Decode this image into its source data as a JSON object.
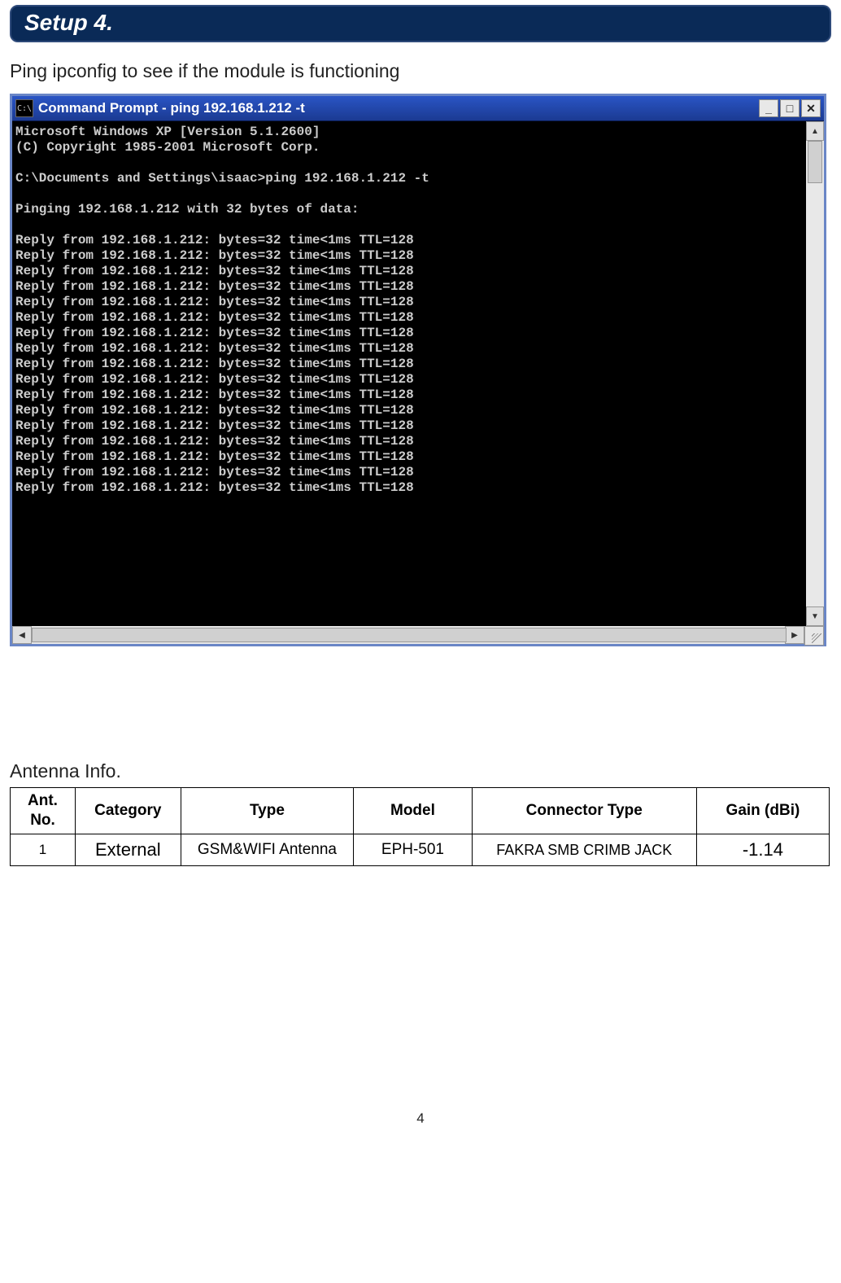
{
  "section_banner": "Setup 4.",
  "intro_text": "Ping ipconfig to see if the module is functioning",
  "cmd": {
    "icon_label": "C:\\",
    "title": "Command Prompt - ping 192.168.1.212 -t",
    "min_glyph": "_",
    "max_glyph": "□",
    "close_glyph": "✕",
    "scroll_up": "▲",
    "scroll_down": "▼",
    "scroll_left": "◀",
    "scroll_right": "▶",
    "lines": [
      "Microsoft Windows XP [Version 5.1.2600]",
      "(C) Copyright 1985-2001 Microsoft Corp.",
      "",
      "C:\\Documents and Settings\\isaac>ping 192.168.1.212 -t",
      "",
      "Pinging 192.168.1.212 with 32 bytes of data:",
      "",
      "Reply from 192.168.1.212: bytes=32 time<1ms TTL=128",
      "Reply from 192.168.1.212: bytes=32 time<1ms TTL=128",
      "Reply from 192.168.1.212: bytes=32 time<1ms TTL=128",
      "Reply from 192.168.1.212: bytes=32 time<1ms TTL=128",
      "Reply from 192.168.1.212: bytes=32 time<1ms TTL=128",
      "Reply from 192.168.1.212: bytes=32 time<1ms TTL=128",
      "Reply from 192.168.1.212: bytes=32 time<1ms TTL=128",
      "Reply from 192.168.1.212: bytes=32 time<1ms TTL=128",
      "Reply from 192.168.1.212: bytes=32 time<1ms TTL=128",
      "Reply from 192.168.1.212: bytes=32 time<1ms TTL=128",
      "Reply from 192.168.1.212: bytes=32 time<1ms TTL=128",
      "Reply from 192.168.1.212: bytes=32 time<1ms TTL=128",
      "Reply from 192.168.1.212: bytes=32 time<1ms TTL=128",
      "Reply from 192.168.1.212: bytes=32 time<1ms TTL=128",
      "Reply from 192.168.1.212: bytes=32 time<1ms TTL=128",
      "Reply from 192.168.1.212: bytes=32 time<1ms TTL=128",
      "Reply from 192.168.1.212: bytes=32 time<1ms TTL=128"
    ]
  },
  "antenna": {
    "heading": "Antenna Info.",
    "headers": {
      "ant_no": "Ant.\nNo.",
      "category": "Category",
      "type": "Type",
      "model": "Model",
      "connector": "Connector Type",
      "gain": "Gain (dBi)"
    },
    "rows": [
      {
        "no": "1",
        "category": "External",
        "type": "GSM&WIFI Antenna",
        "model": "EPH-501",
        "connector": "FAKRA SMB CRIMB JACK",
        "gain": "-1.14"
      }
    ]
  },
  "page_number": "4"
}
